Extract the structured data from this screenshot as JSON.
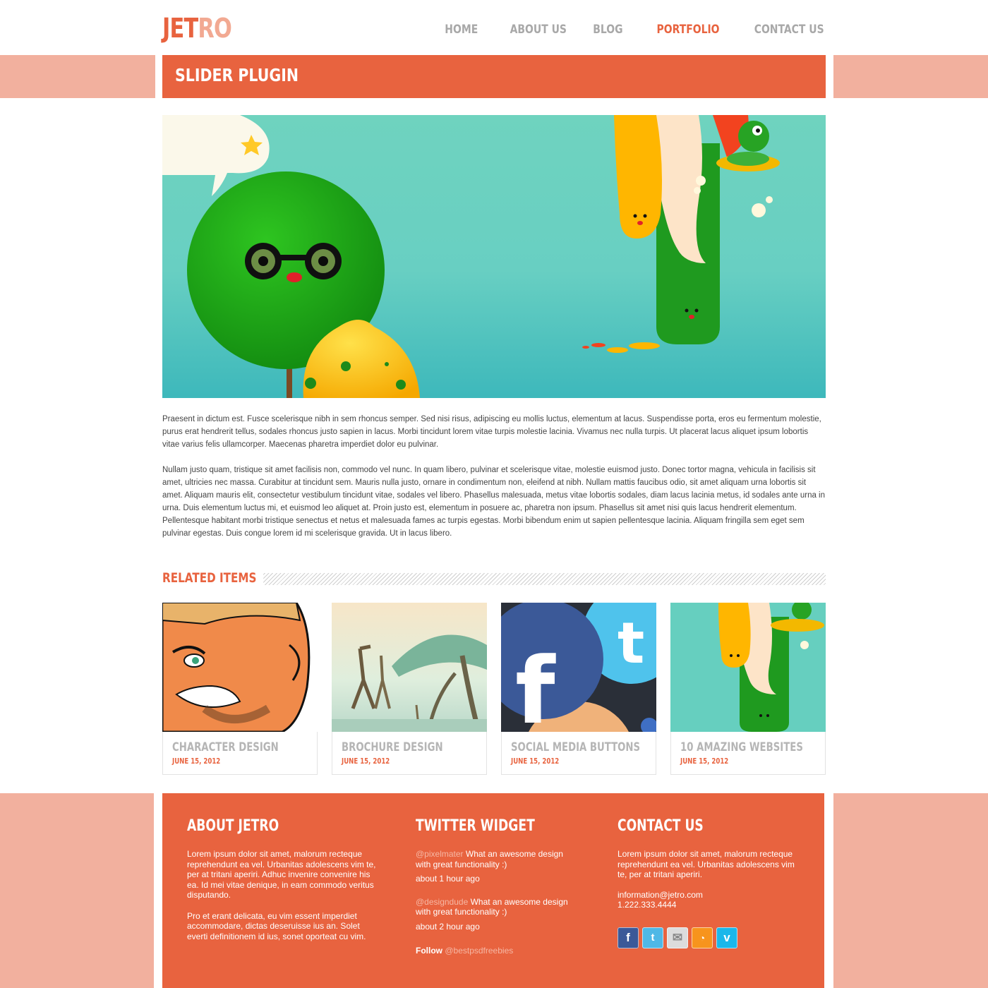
{
  "header": {
    "logo_part1": "JET",
    "logo_part2": "RO",
    "nav": [
      "HOME",
      "ABOUT US",
      "BLOG",
      "PORTFOLIO",
      "CONTACT US"
    ],
    "active_nav": "PORTFOLIO"
  },
  "page": {
    "title": "SLIDER PLUGIN",
    "paragraphs": [
      "Praesent in dictum est. Fusce scelerisque nibh in sem rhoncus semper. Sed nisi risus, adipiscing eu mollis luctus, elementum at lacus. Suspendisse porta, eros eu fermentum molestie, purus erat hendrerit tellus, sodales rhoncus justo sapien in lacus. Morbi tincidunt lorem vitae turpis molestie lacinia. Vivamus nec nulla turpis. Ut placerat lacus aliquet ipsum lobortis vitae varius felis ullamcorper. Maecenas pharetra imperdiet dolor eu pulvinar.",
      "Nullam justo quam, tristique sit amet facilisis non, commodo vel nunc. In quam libero, pulvinar et scelerisque vitae, molestie euismod justo. Donec tortor magna, vehicula in facilisis sit amet, ultricies nec massa. Curabitur at tincidunt sem. Mauris nulla justo, ornare in condimentum non, eleifend at nibh. Nullam mattis faucibus odio, sit amet aliquam urna lobortis sit amet. Aliquam mauris elit, consectetur vestibulum tincidunt vitae, sodales vel libero. Phasellus malesuada, metus vitae lobortis sodales, diam lacus lacinia metus, id sodales ante urna in urna. Duis elementum luctus mi, et euismod leo aliquet at. Proin justo est, elementum in posuere ac, pharetra non ipsum. Phasellus sit amet nisi quis lacus hendrerit elementum. Pellentesque habitant morbi tristique senectus et netus et malesuada fames ac turpis egestas. Morbi bibendum enim ut sapien pellentesque lacinia. Aliquam fringilla sem eget sem pulvinar egestas. Duis congue lorem id mi scelerisque gravida. Ut in lacus libero."
    ]
  },
  "related": {
    "heading": "RELATED ITEMS",
    "items": [
      {
        "title": "CHARACTER DESIGN",
        "date": "JUNE 15, 2012"
      },
      {
        "title": "BROCHURE DESIGN",
        "date": "JUNE 15, 2012"
      },
      {
        "title": "SOCIAL MEDIA BUTTONS",
        "date": "JUNE 15, 2012"
      },
      {
        "title": "10 AMAZING WEBSITES",
        "date": "JUNE 15, 2012"
      }
    ]
  },
  "footer": {
    "about": {
      "heading": "ABOUT JETRO",
      "p1": "Lorem ipsum dolor sit amet, malorum recteque reprehendunt ea vel. Urbanitas adolescens vim te, per at tritani aperiri. Adhuc invenire convenire his ea. Id mei vitae denique, in eam commodo veritus disputando.",
      "p2": "Pro et erant delicata, eu vim essent imperdiet accommodare, dictas deseruisse ius an. Solet everti definitionem id ius, sonet oporteat cu vim."
    },
    "twitter": {
      "heading": "TWITTER WIDGET",
      "tweets": [
        {
          "handle": "@pixelmater",
          "text": " What an awesome design with great functionality :)",
          "time": "about 1 hour ago"
        },
        {
          "handle": "@designdude",
          "text": " What an awesome design with great functionality :)",
          "time": "about 2 hour ago"
        }
      ],
      "follow_label": "Follow",
      "follow_handle": "@bestpsdfreebies"
    },
    "contact": {
      "heading": "CONTACT US",
      "text": "Lorem ipsum dolor sit amet, malorum recteque reprehendunt ea vel. Urbanitas adolescens vim te, per at tritani aperiri.",
      "email": "information@jetro.com",
      "phone": "1.222.333.4444",
      "social_icons": [
        "facebook-icon",
        "twitter-icon",
        "email-icon",
        "rss-icon",
        "vimeo-icon"
      ]
    }
  },
  "colors": {
    "accent": "#e8633f",
    "accent_light": "#f2b09e",
    "nav_inactive": "#a8a8a8",
    "card_title": "#b5b5b5"
  }
}
